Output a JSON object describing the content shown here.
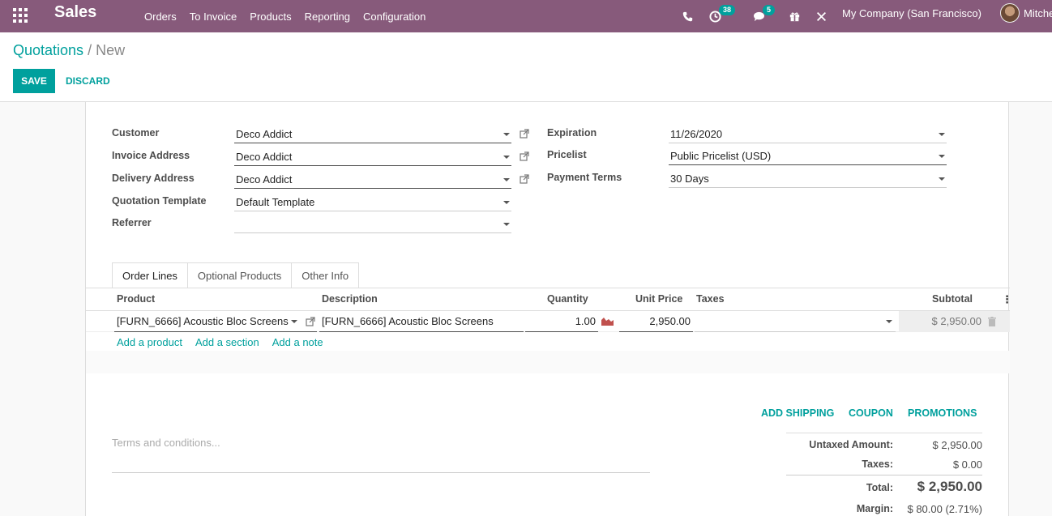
{
  "navbar": {
    "app_name": "Sales",
    "menu": [
      "Orders",
      "To Invoice",
      "Products",
      "Reporting",
      "Configuration"
    ],
    "activity_count": "38",
    "messages_count": "5",
    "company": "My Company (San Francisco)",
    "user": "Mitchell"
  },
  "breadcrumb": {
    "parent": "Quotations",
    "separator": "/",
    "current": "New"
  },
  "buttons": {
    "save": "SAVE",
    "discard": "DISCARD"
  },
  "form": {
    "customer_label": "Customer",
    "customer": "Deco Addict",
    "invoice_address_label": "Invoice Address",
    "invoice_address": "Deco Addict",
    "delivery_address_label": "Delivery Address",
    "delivery_address": "Deco Addict",
    "quotation_template_label": "Quotation Template",
    "quotation_template": "Default Template",
    "referrer_label": "Referrer",
    "referrer": "",
    "expiration_label": "Expiration",
    "expiration": "11/26/2020",
    "pricelist_label": "Pricelist",
    "pricelist": "Public Pricelist (USD)",
    "payment_terms_label": "Payment Terms",
    "payment_terms": "30 Days"
  },
  "tabs": [
    "Order Lines",
    "Optional Products",
    "Other Info"
  ],
  "order_lines": {
    "headers": {
      "product": "Product",
      "description": "Description",
      "quantity": "Quantity",
      "unit_price": "Unit Price",
      "taxes": "Taxes",
      "subtotal": "Subtotal"
    },
    "row": {
      "product": "[FURN_6666] Acoustic Bloc Screens",
      "description": "[FURN_6666] Acoustic Bloc Screens",
      "quantity": "1.00",
      "unit_price": "2,950.00",
      "taxes": "",
      "subtotal": "$ 2,950.00"
    },
    "add_links": [
      "Add a product",
      "Add a section",
      "Add a note"
    ]
  },
  "actions": {
    "add_shipping": "ADD SHIPPING",
    "coupon": "COUPON",
    "promotions": "PROMOTIONS"
  },
  "terms_placeholder": "Terms and conditions...",
  "totals": {
    "untaxed_label": "Untaxed Amount:",
    "untaxed": "$ 2,950.00",
    "taxes_label": "Taxes:",
    "taxes": "$ 0.00",
    "total_label": "Total:",
    "total": "$ 2,950.00",
    "margin_label": "Margin:",
    "margin": "$ 80.00 (2.71%)"
  },
  "colors": {
    "navbar": "#875a7b",
    "accent": "#00a09d"
  }
}
